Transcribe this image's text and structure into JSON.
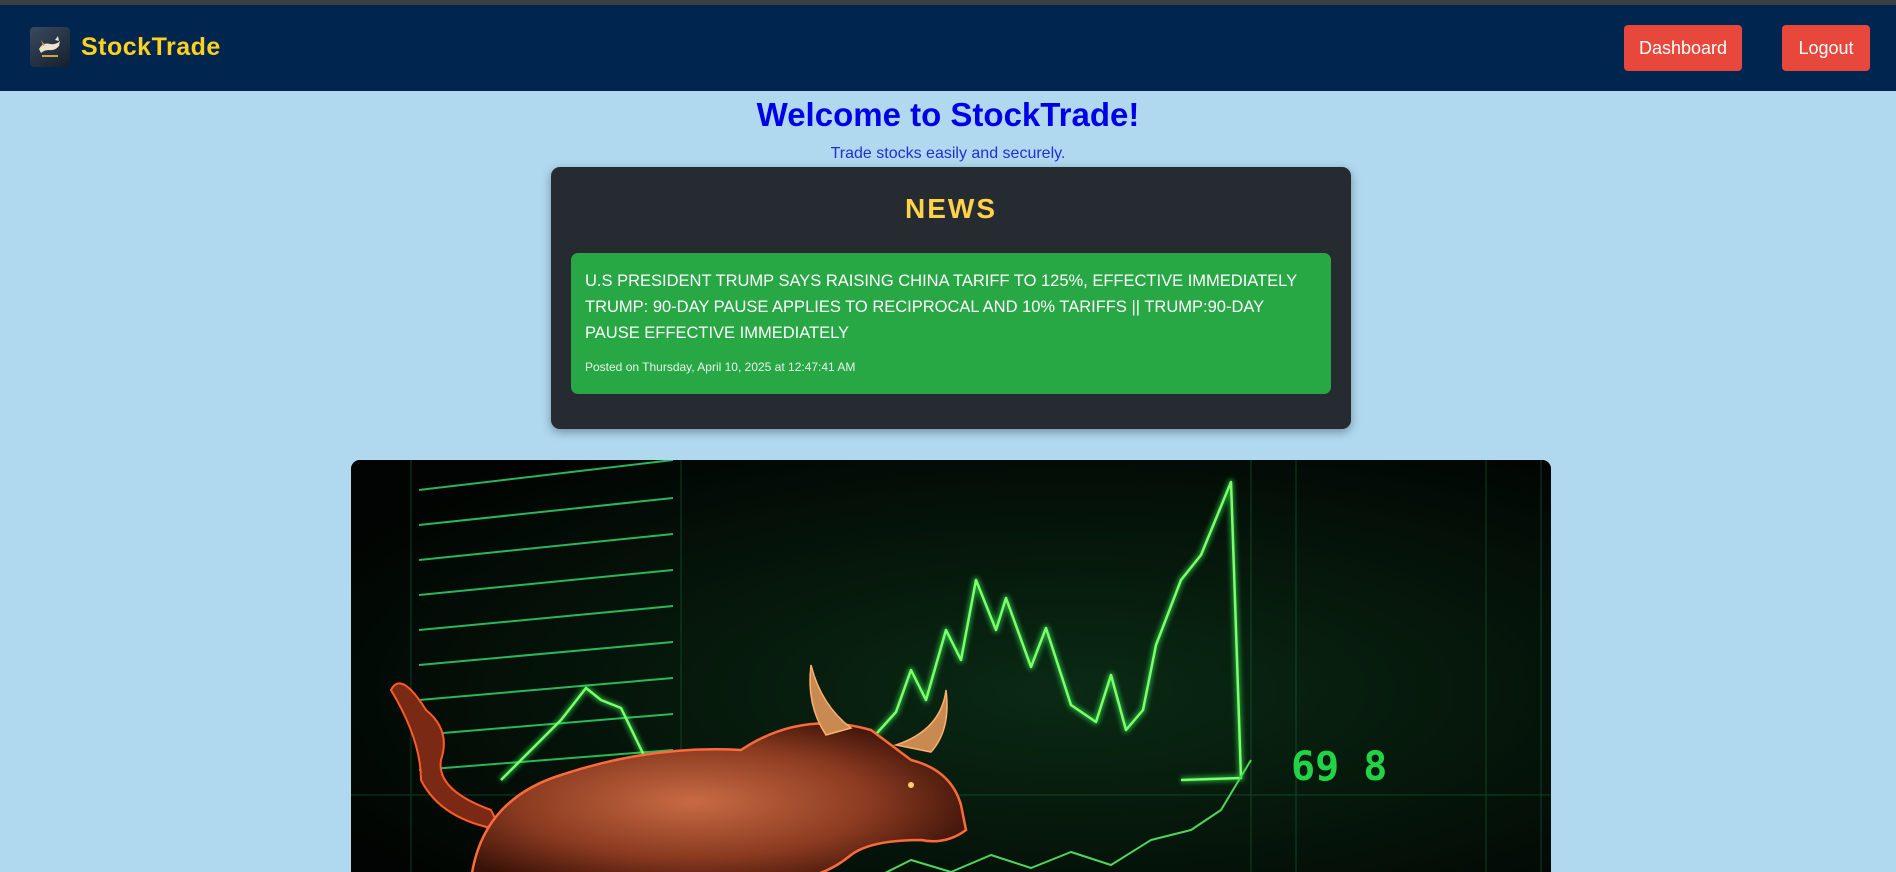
{
  "navbar": {
    "brand_name": "StockTrade",
    "logo_icon": "bull-logo-icon",
    "dashboard_label": "Dashboard",
    "logout_label": "Logout"
  },
  "hero_text": {
    "title": "Welcome to StockTrade!",
    "tagline": "Trade stocks easily and securely."
  },
  "news": {
    "heading": "NEWS",
    "items": [
      {
        "headline": "U.S PRESIDENT TRUMP SAYS RAISING CHINA TARIFF TO 125%, EFFECTIVE IMMEDIATELY TRUMP: 90-DAY PAUSE APPLIES TO RECIPROCAL AND 10% TARIFFS || TRUMP:90-DAY PAUSE EFFECTIVE IMMEDIATELY",
        "posted": "Posted on Thursday, April 10, 2025 at 12:47:41 AM"
      }
    ]
  },
  "banner": {
    "ticker_digits": "69 8",
    "image_icon": "bull-market-banner-image"
  },
  "colors": {
    "navbar": "#00254f",
    "brand": "#ffd21f",
    "button": "#e8473b",
    "page_bg": "#b0d9f0",
    "news_panel": "#262b31",
    "news_card": "#28a745",
    "news_heading": "#ffd24a",
    "welcome": "#0000e6"
  }
}
